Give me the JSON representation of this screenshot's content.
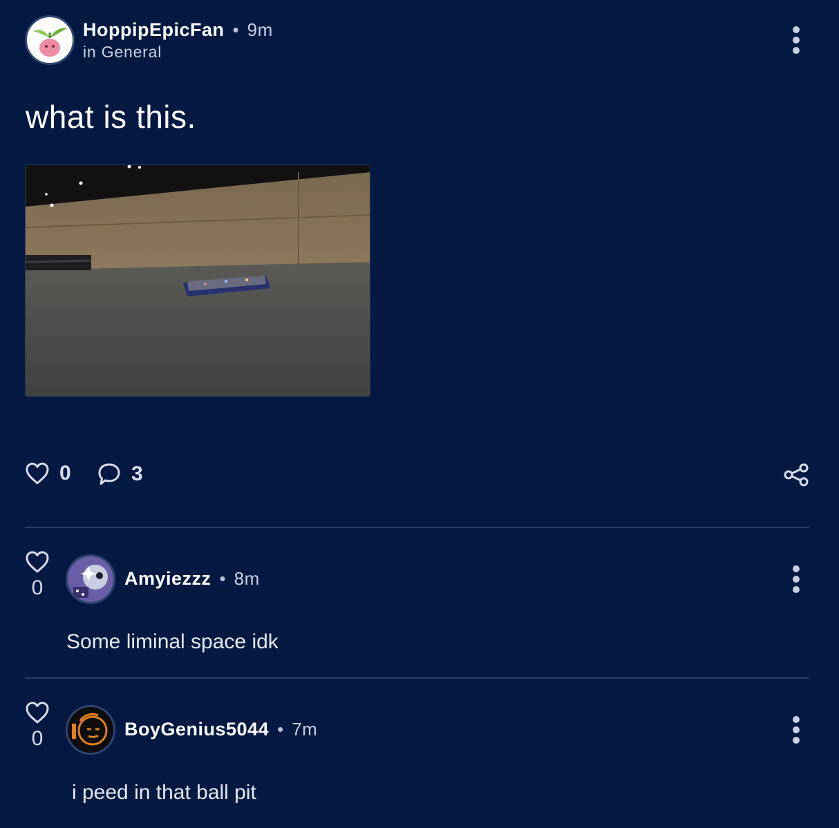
{
  "post": {
    "author": "HoppipEpicFan",
    "separator": "•",
    "time": "9m",
    "community": "in General",
    "title": "what is this.",
    "likes": "0",
    "comments": "3"
  },
  "comments": [
    {
      "author": "Amyiezzz",
      "separator": "•",
      "time": "8m",
      "likes": "0",
      "text": "Some liminal space idk"
    },
    {
      "author": "BoyGenius5044",
      "separator": "•",
      "time": "7m",
      "likes": "0",
      "text": "i peed in that ball pit"
    }
  ],
  "icons": {
    "more": "kebab-icon",
    "like": "heart-icon",
    "comment": "speech-bubble-icon",
    "share": "share-icon"
  },
  "colors": {
    "background": "#031942",
    "divider": "#2b3e60",
    "muted_text": "#c9d0e0"
  }
}
